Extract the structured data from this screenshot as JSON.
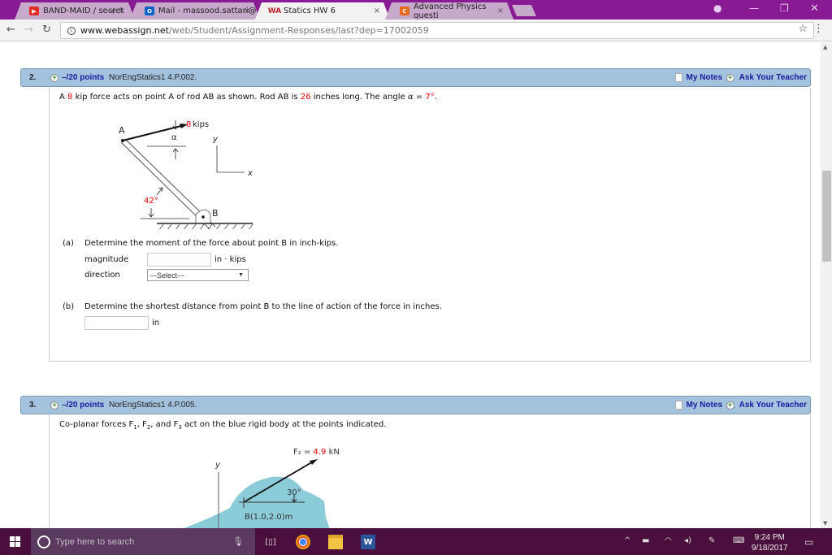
{
  "browser": {
    "tabs": [
      {
        "title": "BAND-MAID / secret",
        "icon": "youtube-icon",
        "icon_color": "#e52d27",
        "active": false
      },
      {
        "title": "Mail - massood.sattari@",
        "icon": "outlook-icon",
        "icon_color": "#0a64c6",
        "active": false
      },
      {
        "title": "Statics HW 6",
        "icon": "webassign-icon",
        "icon_color": "#b8222a",
        "active": true
      },
      {
        "title": "Advanced Physics questi",
        "icon": "chegg-icon",
        "icon_color": "#e86a1c",
        "active": false
      }
    ],
    "url_host": "www.webassign.net",
    "url_path": "/web/Student/Assignment-Responses/last?dep=17002059"
  },
  "questions": [
    {
      "number": "2.",
      "points": "–/20 points",
      "id": "NorEngStatics1 4.P.002.",
      "my_notes": "My Notes",
      "ask_teacher": "Ask Your Teacher",
      "statement": {
        "p1": "A ",
        "force": "8",
        "p2": " kip force acts on point A of rod AB as shown. Rod AB is ",
        "length": "26",
        "p3": " inches long. The angle ",
        "alpha": "α",
        "p4": " = ",
        "angle": "7°",
        "p5": "."
      },
      "figure": {
        "force_value": "8",
        "force_unit": "kips",
        "point_a": "A",
        "point_b": "B",
        "alpha": "α",
        "angle": "42°",
        "axis_x": "x",
        "axis_y": "y"
      },
      "part_a": {
        "label": "(a)",
        "text": "Determine the moment of the force about point B in inch-kips.",
        "magnitude_label": "magnitude",
        "magnitude_value": "",
        "magnitude_unit": "in · kips",
        "direction_label": "direction",
        "direction_value": "---Select---"
      },
      "part_b": {
        "label": "(b)",
        "text": "Determine the shortest distance from point B to the line of action of the force in inches.",
        "value": "",
        "unit": "in"
      }
    },
    {
      "number": "3.",
      "points": "–/20 points",
      "id": "NorEngStatics1 4.P.005.",
      "my_notes": "My Notes",
      "ask_teacher": "Ask Your Teacher",
      "statement": {
        "p1": "Co-planar forces F",
        "s1": "1",
        "p2": ", F",
        "s2": "2",
        "p3": ", and F",
        "s3": "3",
        "p4": " act on the blue rigid body at the points indicated."
      },
      "figure": {
        "force_label": "F₂ = ",
        "force_value": "4.9",
        "force_unit": " kN",
        "angle": "30°",
        "point": "B(1.0,2.0)m",
        "axis_y": "y",
        "body_color": "#8ccbd8"
      }
    }
  ],
  "taskbar": {
    "search_placeholder": "Type here to search",
    "time": "9:24 PM",
    "date": "9/18/2017"
  }
}
